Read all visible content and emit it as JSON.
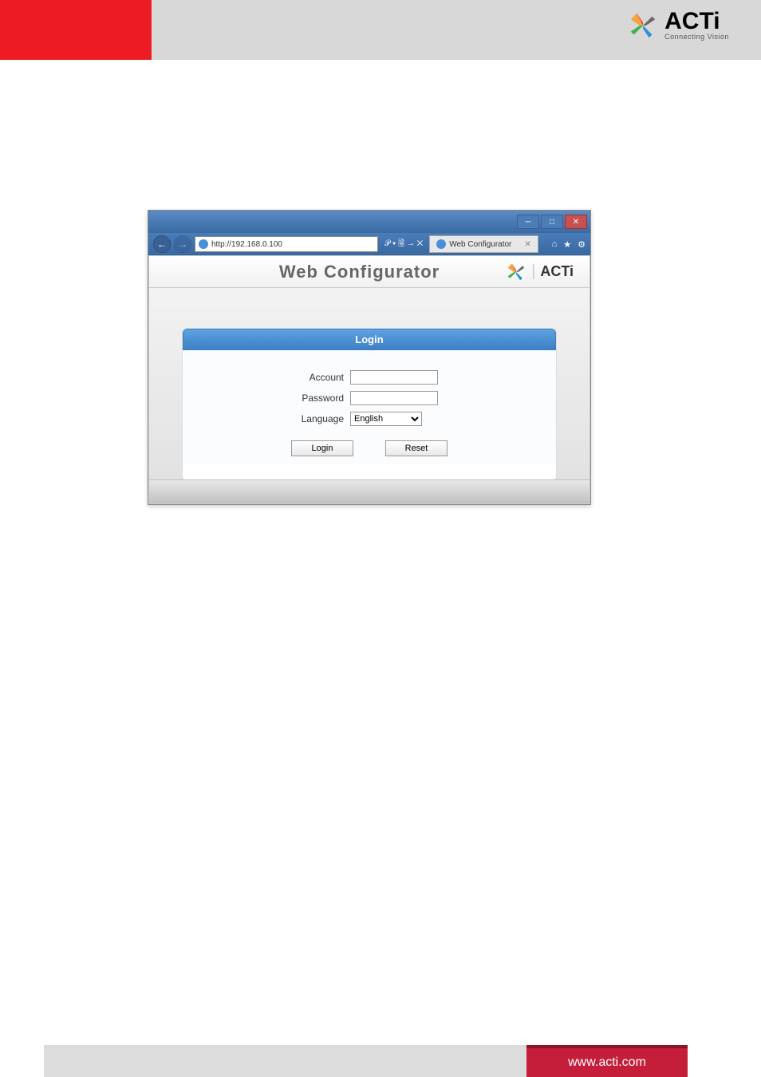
{
  "header": {
    "brand": "ACTi",
    "tagline": "Connecting Vision"
  },
  "browser": {
    "url": "http://192.168.0.100",
    "tab_title": "Web Configurator",
    "search_hint": "𝒫 ▾ 🗟 → ✕"
  },
  "page": {
    "title": "Web Configurator",
    "brand": "ACTi"
  },
  "login": {
    "header": "Login",
    "account_label": "Account",
    "password_label": "Password",
    "language_label": "Language",
    "language_value": "English",
    "login_button": "Login",
    "reset_button": "Reset"
  },
  "footer": {
    "url": "www.acti.com"
  }
}
